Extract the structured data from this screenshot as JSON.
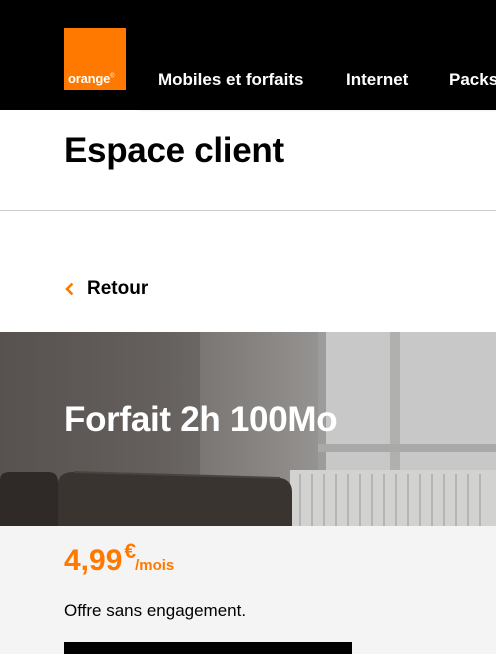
{
  "header": {
    "logo_text": "orange",
    "logo_mark": "®",
    "nav": [
      "Mobiles et forfaits",
      "Internet",
      "Packs"
    ]
  },
  "page_title": "Espace client",
  "back_label": "Retour",
  "hero": {
    "title": "Forfait 2h 100Mo"
  },
  "offer": {
    "price": "4,99",
    "currency": "€",
    "unit": "/mois",
    "note": "Offre sans engagement."
  },
  "colors": {
    "brand": "#ff7900",
    "header_bg": "#000000",
    "offer_bg": "#f4f4f4"
  }
}
